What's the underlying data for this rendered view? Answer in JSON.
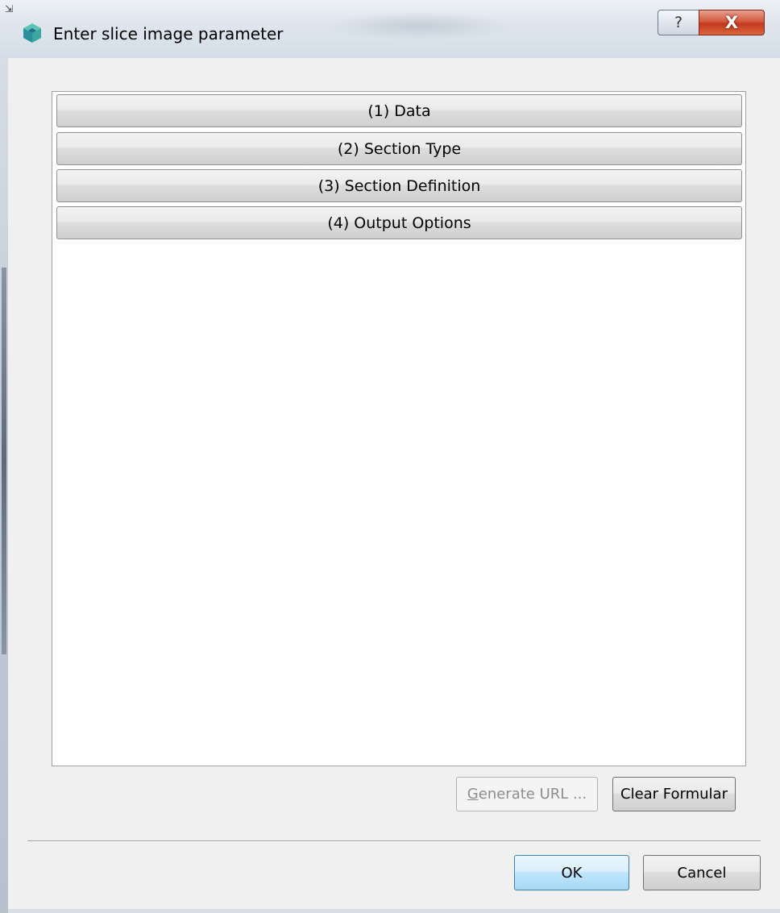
{
  "window": {
    "title": "Enter slice image parameter",
    "help_glyph": "?",
    "close_glyph": "X",
    "resize_glyph": "⇲",
    "icon": "app-cube-icon"
  },
  "sections": [
    {
      "label": "(1) Data"
    },
    {
      "label": "(2) Section Type"
    },
    {
      "label": "(3) Section Definition"
    },
    {
      "label": "(4) Output Options"
    }
  ],
  "actions": {
    "generate_url_mnemonic": "G",
    "generate_url_rest": "enerate URL ...",
    "generate_url_enabled": false,
    "clear_formular": "Clear Formular"
  },
  "dialog_buttons": {
    "ok": "OK",
    "cancel": "Cancel"
  },
  "colors": {
    "close_button": "#c2391c",
    "default_button_border": "#3c7fb1",
    "app_icon_primary": "#3aa8a0",
    "app_icon_secondary": "#2b7f9c"
  }
}
